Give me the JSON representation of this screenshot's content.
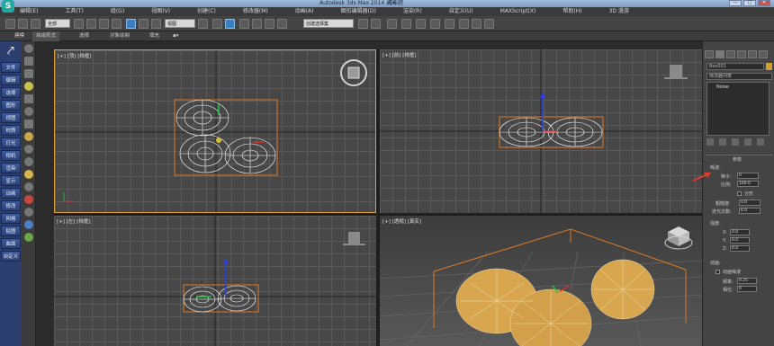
{
  "titlebar": {
    "app_title": "Autodesk 3ds Max  2014 x64",
    "doc_title": "无标题",
    "minimize": "—",
    "maximize": "□",
    "close": "✕"
  },
  "menu": [
    "编辑(E)",
    "工具(T)",
    "组(G)",
    "视图(V)",
    "创建(C)",
    "修改器(M)",
    "动画(A)",
    "图形编辑器(D)",
    "渲染(R)",
    "自定义(U)",
    "MAXScript(X)",
    "帮助(H)",
    "3D 漫游"
  ],
  "toolbar": {
    "selection_filter": "全部",
    "view_dropdown": "视图",
    "named_set": "创建选择集"
  },
  "ribbon": {
    "items": [
      "建模",
      "自由形式",
      "选择",
      "对象绘制",
      "填充"
    ],
    "active_index": 1
  },
  "command_panel_left": [
    "文件",
    "编辑",
    "选择",
    "图形",
    "视图",
    "材质",
    "灯光",
    "相机",
    "渲染",
    "显示",
    "动画",
    "修改",
    "网格",
    "贴图",
    "曲面",
    "自定义"
  ],
  "viewports": {
    "top": "[+] [顶] [线框]",
    "front": "[+] [前] [线框]",
    "left": "[+] [左] [线框]",
    "perspective": "[+] [透视] [真实]"
  },
  "right_panel": {
    "object_name": "Box001",
    "modifier_list": "修改器列表",
    "stack_item": "Noise",
    "params_title": "参数",
    "noise_group": "噪波:",
    "seed_label": "种子:",
    "seed_value": "0",
    "scale_label": "比例:",
    "scale_value": "100.0",
    "fractal_label": "分形",
    "roughness_label": "粗糙度:",
    "roughness_value": "0.0",
    "iterations_label": "迭代次数:",
    "iterations_value": "6.0",
    "strength_group": "强度:",
    "x_label": "X:",
    "x_value": "0.0",
    "y_label": "Y:",
    "y_value": "0.0",
    "z_label": "Z:",
    "z_value": "0.0",
    "animation_group": "动画:",
    "animate_noise_label": "动画噪波",
    "frequency_label": "频率:",
    "frequency_value": "0.25",
    "phase_label": "相位:",
    "phase_value": "0"
  },
  "colors": {
    "active_viewport_border": "#e0a040",
    "bounding_box": "#e07a20",
    "command_panel_blue": "#2d3f6f",
    "annotation_arrow": "#e23b2e",
    "shaded_mesh": "#d9a650"
  }
}
